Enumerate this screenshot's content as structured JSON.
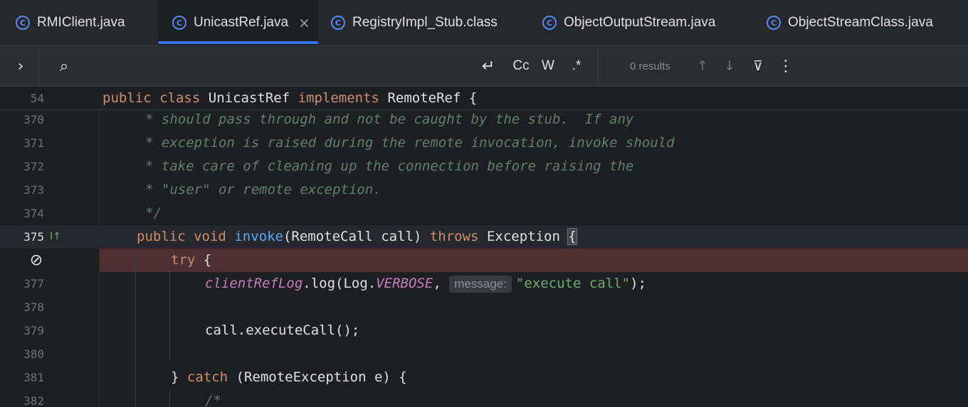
{
  "tabs": [
    {
      "label": "RMIClient.java",
      "active": false
    },
    {
      "label": "UnicastRef.java",
      "active": true,
      "close": "×"
    },
    {
      "label": "RegistryImpl_Stub.class",
      "active": false
    },
    {
      "label": "ObjectOutputStream.java",
      "active": false
    },
    {
      "label": "ObjectStreamClass.java",
      "active": false
    }
  ],
  "tab_icon_glyph": "C",
  "findbar": {
    "expand_glyph": "›",
    "search_glyph": "⌕",
    "newline_glyph": "↵",
    "case_label": "Cc",
    "word_label": "W",
    "regex_label": ".*",
    "results": "0 results",
    "prev_glyph": "↑",
    "next_glyph": "↓",
    "filter_glyph": "⊽",
    "more_glyph": "⋮"
  },
  "sticky": {
    "line_number": "54",
    "kw1": "public",
    "kw2": "class",
    "name": "UnicastRef",
    "kw3": "implements",
    "iface": "RemoteRef {"
  },
  "lines": {
    "l370": {
      "num": "370",
      "text": "* should pass through and not be caught by the stub.  If any"
    },
    "l371": {
      "num": "371",
      "text": "* exception is raised during the remote invocation, invoke should"
    },
    "l372": {
      "num": "372",
      "text": "* take care of cleaning up the connection before raising the"
    },
    "l373": {
      "num": "373",
      "text": "* \"user\" or remote exception."
    },
    "l374": {
      "num": "374",
      "text": "*/"
    },
    "l375": {
      "num": "375",
      "kw1": "public",
      "kw2": "void",
      "fn": "invoke",
      "params": "(RemoteCall call) ",
      "kw3": "throws",
      "exc": " Exception ",
      "brace": "{",
      "gutter_icon": "I↑"
    },
    "l376": {
      "kw": "try",
      "rest": " {",
      "bp_glyph": "⊘"
    },
    "l377": {
      "num": "377",
      "field": "clientRefLog",
      "call": ".log(Log.",
      "const": "VERBOSE",
      "comma": ", ",
      "hint": "message:",
      "str": "\"execute call\"",
      "end": ");"
    },
    "l378": {
      "num": "378"
    },
    "l379": {
      "num": "379",
      "text": "call.executeCall();"
    },
    "l380": {
      "num": "380"
    },
    "l381": {
      "num": "381",
      "brace": "} ",
      "kw": "catch",
      "rest": " (RemoteException e) {"
    },
    "l382": {
      "num": "382",
      "text": "/*"
    }
  },
  "colors": {
    "accent": "#3574f0",
    "keyword": "#cf8e6d",
    "function": "#56a8f5",
    "comment": "#5f826b",
    "string": "#6aab73",
    "field": "#c77dbb",
    "breakpoint_line": "#4e2f33"
  }
}
